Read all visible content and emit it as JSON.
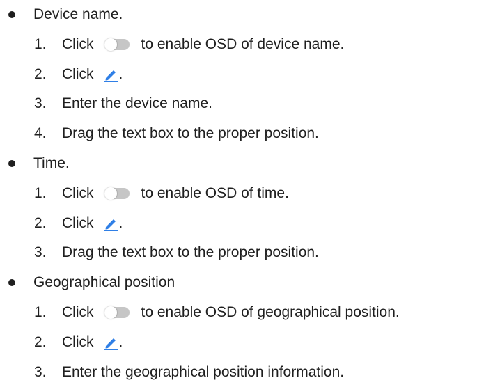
{
  "sections": [
    {
      "title": "Device name.",
      "steps": [
        {
          "num": "1.",
          "pre": "Click",
          "icon": "toggle-off-icon",
          "post": "to enable OSD of device name."
        },
        {
          "num": "2.",
          "pre": "Click",
          "icon": "edit-pencil-icon",
          "post": "."
        },
        {
          "num": "3.",
          "text": "Enter the device name."
        },
        {
          "num": "4.",
          "text": "Drag the text box to the proper position."
        }
      ]
    },
    {
      "title": "Time.",
      "steps": [
        {
          "num": "1.",
          "pre": "Click",
          "icon": "toggle-off-icon",
          "post": "to enable OSD of time."
        },
        {
          "num": "2.",
          "pre": "Click",
          "icon": "edit-pencil-icon",
          "post": "."
        },
        {
          "num": "3.",
          "text": "Drag the text box to the proper position."
        }
      ]
    },
    {
      "title": "Geographical position",
      "steps": [
        {
          "num": "1.",
          "pre": "Click",
          "icon": "toggle-off-icon",
          "post": "to enable OSD of geographical position."
        },
        {
          "num": "2.",
          "pre": "Click",
          "icon": "edit-pencil-icon",
          "post": "."
        },
        {
          "num": "3.",
          "text": "Enter the geographical position information."
        }
      ]
    }
  ],
  "colors": {
    "text": "#1f1f1f",
    "toggle_track": "#c6c6c6",
    "pencil": "#2f7fe6"
  }
}
